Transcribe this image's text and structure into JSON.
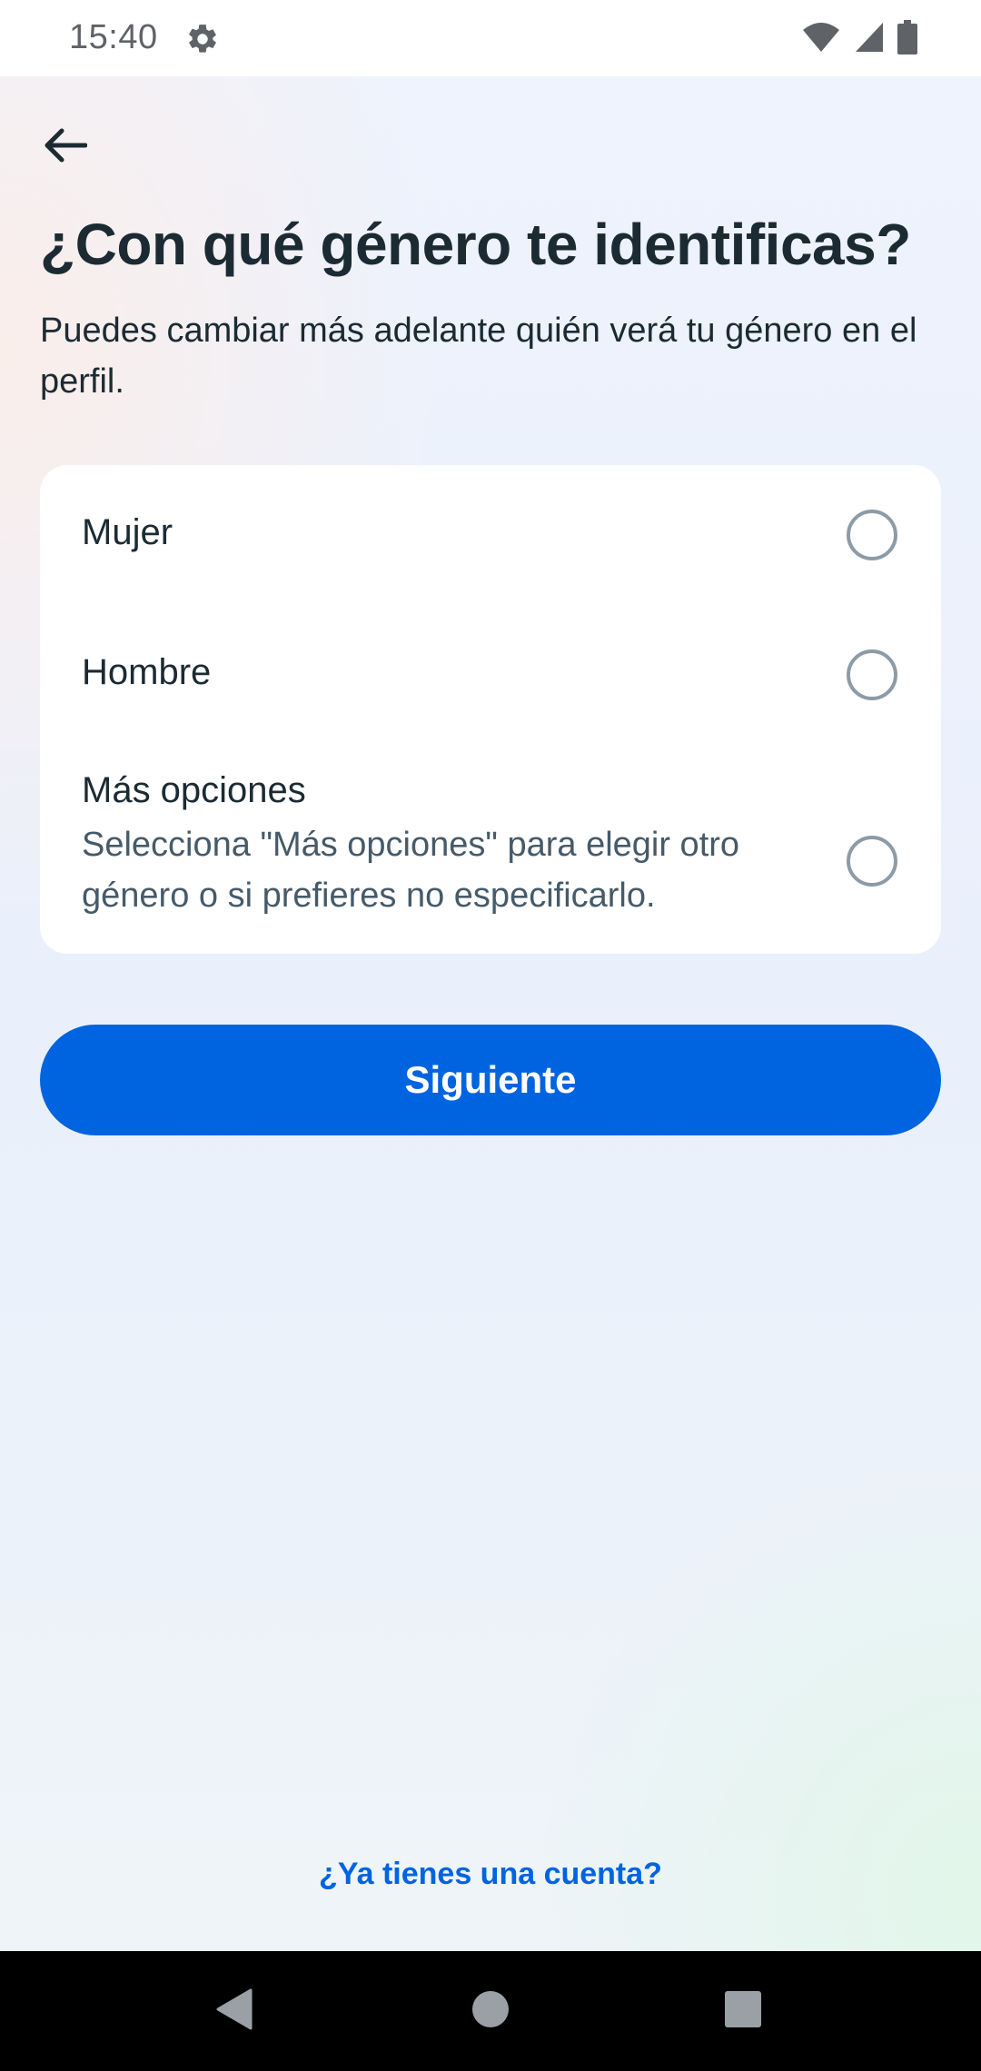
{
  "status_bar": {
    "time": "15:40",
    "icons": [
      "gear-icon",
      "wifi-icon",
      "signal-icon",
      "battery-icon"
    ]
  },
  "header": {
    "back_icon": "arrow-left-icon",
    "title": "¿Con qué género te identificas?",
    "subtitle": "Puedes cambiar más adelante quién verá tu género en el perfil."
  },
  "options": [
    {
      "label": "Mujer",
      "selected": false
    },
    {
      "label": "Hombre",
      "selected": false
    },
    {
      "label": "Más opciones",
      "description": "Selecciona \"Más opciones\" para elegir otro género o si prefieres no especificarlo.",
      "selected": false
    }
  ],
  "next_button": {
    "label": "Siguiente"
  },
  "login_link": {
    "label": "¿Ya tienes una cuenta?"
  },
  "nav_bar": {
    "icons": [
      "back-triangle-icon",
      "home-circle-icon",
      "recents-square-icon"
    ]
  },
  "colors": {
    "accent": "#0064e0",
    "text_primary": "#1c2b33",
    "text_secondary": "#465a69",
    "radio_border": "#8d9ba6"
  }
}
